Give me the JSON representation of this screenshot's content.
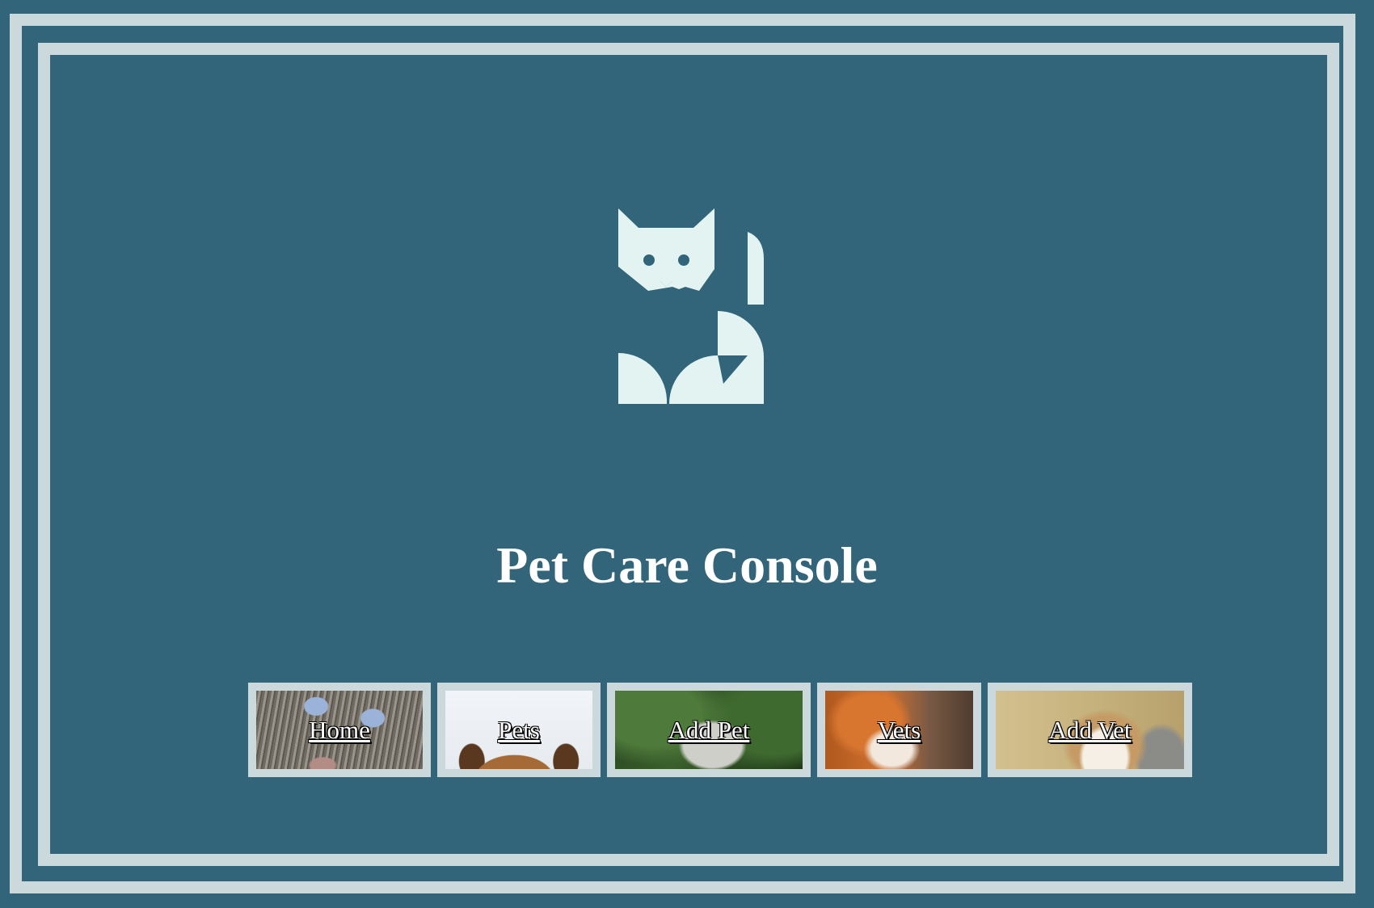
{
  "app": {
    "title": "Pet Care Console",
    "logo_icon": "cat-logo-icon"
  },
  "colors": {
    "background": "#326579",
    "frame": "#cbd8dc",
    "logo": "#e3f3f2",
    "title": "#ffffff"
  },
  "nav": {
    "items": [
      {
        "label": "Home",
        "image": "cat-photo"
      },
      {
        "label": "Pets",
        "image": "dog-photo"
      },
      {
        "label": "Add Pet",
        "image": "ostrich-photo"
      },
      {
        "label": "Vets",
        "image": "fox-photo"
      },
      {
        "label": "Add Vet",
        "image": "owl-photo"
      }
    ]
  }
}
